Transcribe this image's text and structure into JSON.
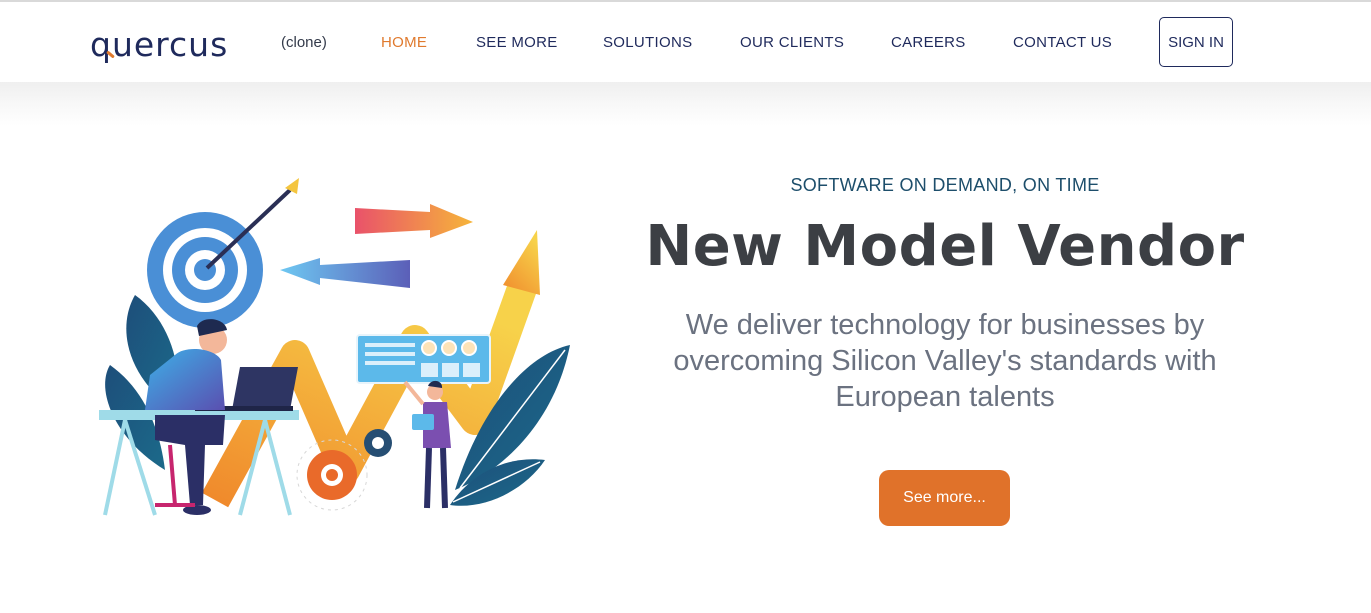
{
  "header": {
    "logo_text": "quercus",
    "clone_tag": "(clone)",
    "nav": [
      {
        "label": "HOME",
        "active": true
      },
      {
        "label": "SEE MORE",
        "active": false
      },
      {
        "label": "SOLUTIONS",
        "active": false
      },
      {
        "label": "OUR CLIENTS",
        "active": false
      },
      {
        "label": "CAREERS",
        "active": false
      },
      {
        "label": "CONTACT US",
        "active": false
      }
    ],
    "signin_label": "SIGN IN"
  },
  "hero": {
    "eyebrow": "SOFTWARE ON DEMAND, ON TIME",
    "title": "New Model Vendor",
    "description": "We deliver technology for businesses by overcoming Silicon Valley's standards with European talents",
    "cta_label": "See more..."
  },
  "colors": {
    "brand_navy": "#1f2a5c",
    "accent_orange": "#e0722a",
    "eyebrow_blue": "#1d4e6b",
    "title_gray": "#3c3f44"
  },
  "icons": [
    "target-icon",
    "arrow-icon",
    "gear-icon",
    "laptop-icon",
    "leaf-icon"
  ]
}
